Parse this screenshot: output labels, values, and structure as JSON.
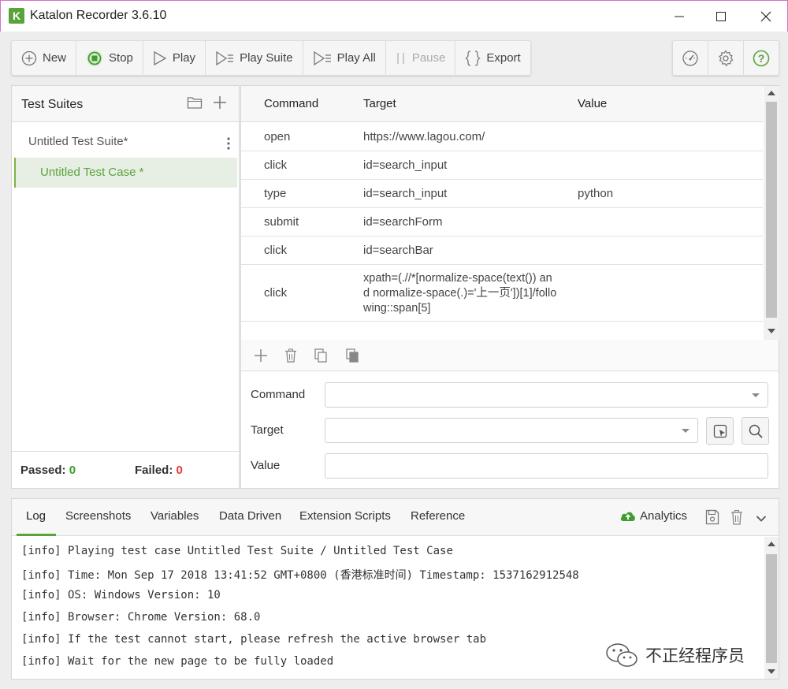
{
  "window": {
    "title": "Katalon Recorder 3.6.10",
    "logo_letter": "K"
  },
  "toolbar": {
    "new_label": "New",
    "stop_label": "Stop",
    "play_label": "Play",
    "play_suite_label": "Play Suite",
    "play_all_label": "Play All",
    "pause_label": "Pause",
    "export_label": "Export"
  },
  "toolbar_right": {
    "icons": [
      "speed-icon",
      "gear-icon",
      "help-icon"
    ]
  },
  "left_panel": {
    "title": "Test Suites",
    "suites": [
      {
        "name": "Untitled Test Suite*",
        "cases": [
          {
            "name": "Untitled Test Case *",
            "selected": true
          }
        ]
      }
    ],
    "passed_label": "Passed:",
    "passed_count": "0",
    "failed_label": "Failed:",
    "failed_count": "0"
  },
  "grid": {
    "headers": {
      "command": "Command",
      "target": "Target",
      "value": "Value"
    },
    "rows": [
      {
        "command": "open",
        "target": "https://www.lagou.com/",
        "value": ""
      },
      {
        "command": "click",
        "target": "id=search_input",
        "value": ""
      },
      {
        "command": "type",
        "target": "id=search_input",
        "value": "python"
      },
      {
        "command": "submit",
        "target": "id=searchForm",
        "value": ""
      },
      {
        "command": "click",
        "target": "id=searchBar",
        "value": ""
      },
      {
        "command": "click",
        "target": "xpath=(.//*[normalize-space(text()) and normalize-space(.)='上一页'])[1]/following::span[5]",
        "target_lines": [
          "xpath=(.//*[normalize-space(text()) an",
          "d normalize-space(.)='上一页'])[1]/follo",
          "wing::span[5]"
        ],
        "value": ""
      }
    ]
  },
  "editor": {
    "command_label": "Command",
    "target_label": "Target",
    "value_label": "Value",
    "command_value": "",
    "target_value": "",
    "value_value": ""
  },
  "log_panel": {
    "tabs": [
      "Log",
      "Screenshots",
      "Variables",
      "Data Driven",
      "Extension Scripts",
      "Reference"
    ],
    "active_tab": "Log",
    "analytics_label": "Analytics",
    "lines": [
      "[info] Playing test case Untitled Test Suite / Untitled Test Case",
      "[info] Time: Mon Sep 17 2018 13:41:52 GMT+0800 (香港标准时间) Timestamp: 1537162912548",
      "[info] OS: Windows Version: 10",
      "[info] Browser: Chrome Version: 68.0",
      "[info] If the test cannot start, please refresh the active browser tab",
      "[info] Wait for the new page to be fully loaded"
    ]
  },
  "watermark": {
    "text": "不正经程序员"
  },
  "colors": {
    "accent": "#5aa33b",
    "passed": "#3f9c2d",
    "failed": "#e53935"
  }
}
